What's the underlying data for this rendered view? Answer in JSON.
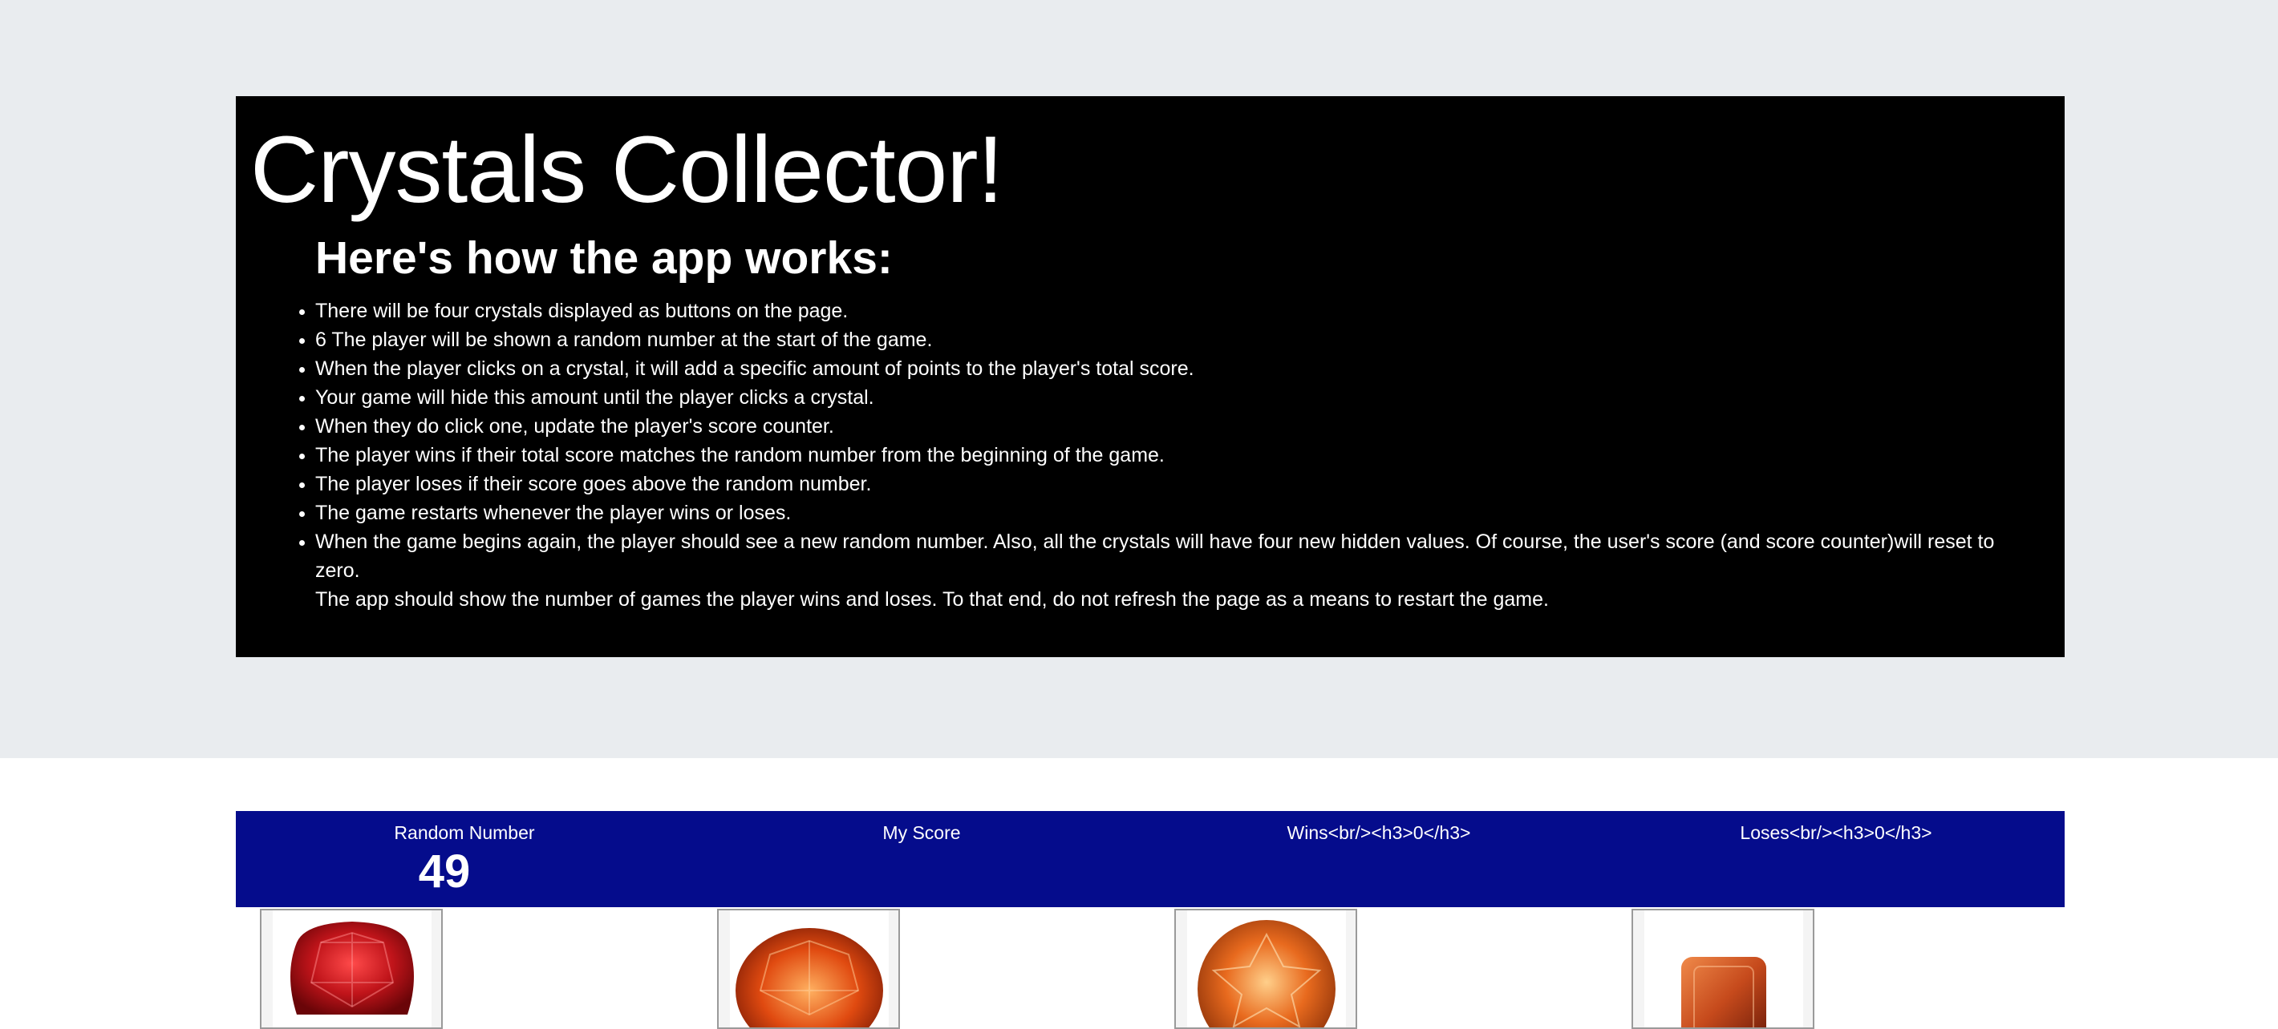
{
  "header": {
    "title": "Crystals Collector!",
    "subtitle": "Here's how the app works:",
    "rules": [
      "There will be four crystals displayed as buttons on the page.",
      "6 The player will be shown a random number at the start of the game.",
      "When the player clicks on a crystal, it will add a specific amount of points to the player's total score.",
      "Your game will hide this amount until the player clicks a crystal.",
      "When they do click one, update the player's score counter.",
      "The player wins if their total score matches the random number from the beginning of the game.",
      "The player loses if their score goes above the random number.",
      "The game restarts whenever the player wins or loses.",
      "When the game begins again, the player should see a new random number. Also, all the crystals will have four new hidden values. Of course, the user's score (and score counter)will reset to zero."
    ],
    "note": "The app should show the number of games the player wins and loses. To that end, do not refresh the page as a means to restart the game."
  },
  "scoreboard": {
    "random_label": "Random Number",
    "random_value": "49",
    "score_label": "My Score",
    "wins_label": "Wins<br/><h3>0</h3>",
    "loses_label": "Loses<br/><h3>0</h3>"
  },
  "crystals": [
    {
      "name": "red-crystal",
      "color": "#c0141a"
    },
    {
      "name": "orange-crystal",
      "color": "#e04a10"
    },
    {
      "name": "amber-crystal",
      "color": "#e86a1e"
    },
    {
      "name": "garnet-crystal",
      "color": "#c64a1c"
    }
  ]
}
